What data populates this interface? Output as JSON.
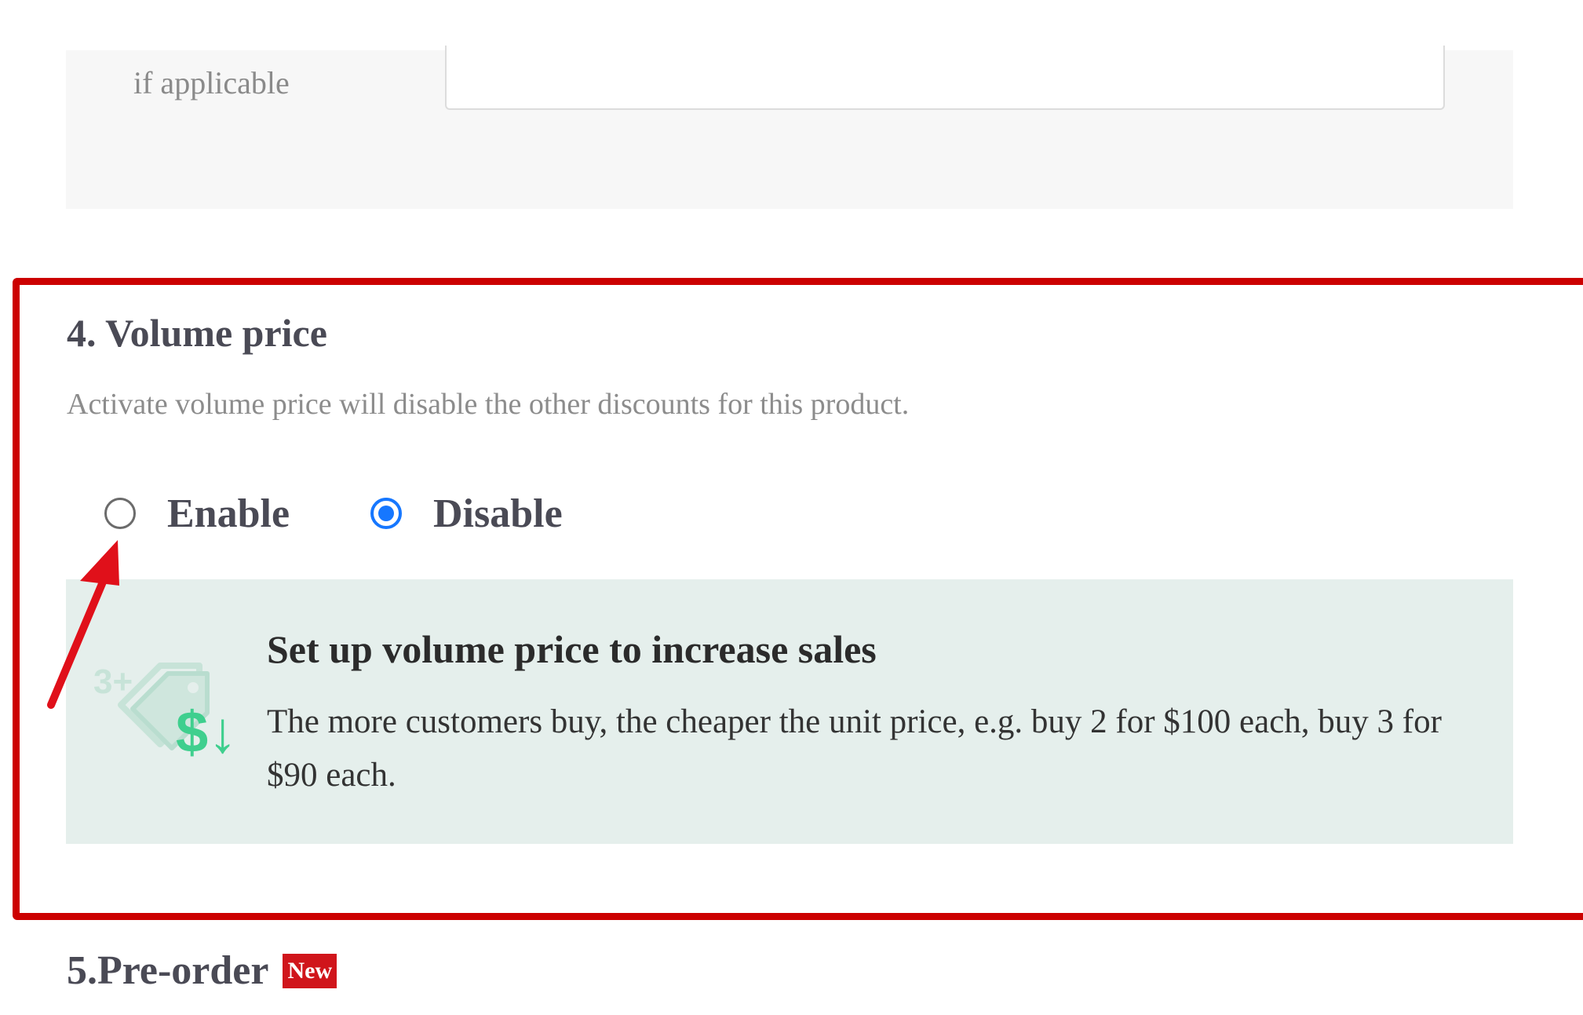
{
  "previous_section": {
    "field_label": "if applicable",
    "field_value": ""
  },
  "volume_price": {
    "title": "4. Volume price",
    "description": "Activate volume price will disable the other discounts for this product.",
    "options": [
      {
        "label": "Enable",
        "selected": false
      },
      {
        "label": "Disable",
        "selected": true
      }
    ],
    "info": {
      "title": "Set up volume price to increase sales",
      "body": "The more customers buy, the cheaper the unit price, e.g. buy 2 for $100 each, buy 3 for $90 each.",
      "icon_text": "3+",
      "icon_price_text": "$↓"
    }
  },
  "next_section": {
    "title": "5.Pre-order",
    "badge": "New"
  },
  "colors": {
    "highlight": "#cc0000",
    "radio_selected": "#1677ff",
    "info_background": "#e5efec",
    "icon_green": "#3fcf8e",
    "badge_background": "#d0151b"
  }
}
